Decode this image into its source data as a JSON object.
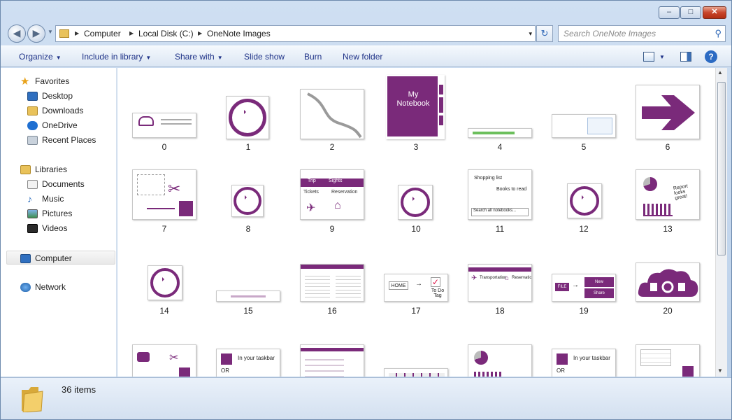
{
  "window": {
    "minimize": "–",
    "maximize": "□",
    "close": "✕"
  },
  "address": {
    "crumbs": [
      "Computer",
      "Local Disk (C:)",
      "OneNote Images"
    ],
    "dropdown": "▾",
    "refresh": "↻"
  },
  "search": {
    "placeholder": "Search OneNote Images",
    "icon": "search-icon"
  },
  "toolbar": {
    "organize": "Organize",
    "include": "Include in library",
    "share": "Share with",
    "slideshow": "Slide show",
    "burn": "Burn",
    "newfolder": "New folder",
    "help": "?"
  },
  "nav": {
    "favorites": {
      "label": "Favorites",
      "items": [
        "Desktop",
        "Downloads",
        "OneDrive",
        "Recent Places"
      ]
    },
    "libraries": {
      "label": "Libraries",
      "items": [
        "Documents",
        "Music",
        "Pictures",
        "Videos"
      ]
    },
    "computer": "Computer",
    "network": "Network"
  },
  "files": [
    "0",
    "1",
    "2",
    "3",
    "4",
    "5",
    "6",
    "7",
    "8",
    "9",
    "10",
    "11",
    "12",
    "13",
    "14",
    "15",
    "16",
    "17",
    "18",
    "19",
    "20"
  ],
  "thumb_text": {
    "notebook": "My Notebook",
    "trip": "Trip",
    "sights": "Sights",
    "tickets": "Tickets",
    "reservation": "Reservation",
    "shopping": "Shopping list",
    "books": "Books to read",
    "searchnb": "Search all notebooks...",
    "report": "Report looks great!",
    "home": "HOME",
    "todo": "To Do Tag",
    "transportation": "Transportation",
    "file": "FILE",
    "new": "New",
    "share": "Share",
    "taskbar": "In your taskbar",
    "or": "OR"
  },
  "status": {
    "count": "36 items"
  },
  "colors": {
    "accent": "#7a2a7a",
    "link": "#1e3287"
  }
}
